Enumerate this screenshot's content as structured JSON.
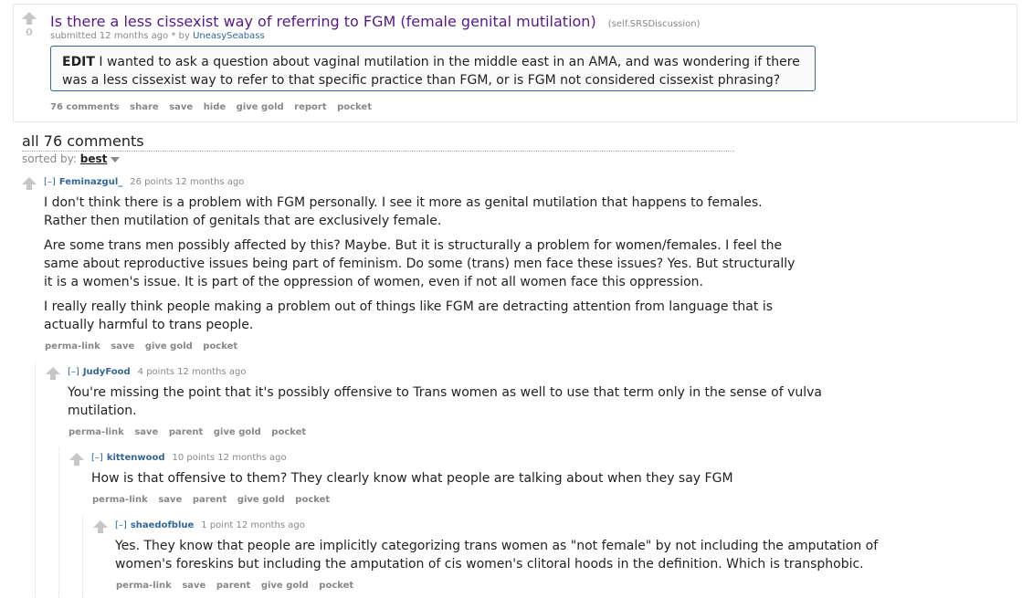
{
  "post": {
    "score": "0",
    "title": "Is there a less cissexist way of referring to FGM (female genital mutilation)",
    "domain": "(self.SRSDiscussion)",
    "tagline_prefix": "submitted 12 months ago * by",
    "author": "UneasySeabass",
    "selftext_bold": "EDIT",
    "selftext": " I wanted to ask a question about vaginal mutilation in the middle east in an AMA, and was wondering if there was a less cissexist way to refer to that specific practice than FGM, or is FGM not considered cissexist phrasing?",
    "buttons": [
      "76 comments",
      "share",
      "save",
      "hide",
      "give gold",
      "report",
      "pocket"
    ]
  },
  "comments_header": "all 76 comments",
  "sort": {
    "label": "sorted by:",
    "value": "best"
  },
  "comments": [
    {
      "expand": "[–]",
      "author": "Feminazgul_",
      "meta": "26 points 12 months ago",
      "paragraphs": [
        "I don't think there is a problem with FGM personally. I see it more as genital mutilation that happens to females. Rather then mutilation of genitals that are exclusively female.",
        "Are some trans men possibly affected by this? Maybe. But it is structurally a problem for women/females. I feel the same about reproductive issues being part of feminism. Do some (trans) men face these issues? Yes. But structurally it is a women's issue. It is part of the oppression of women, even if not all women face this oppression.",
        "I really really think people making a problem out of things like FGM are detracting attention from language that is actually harmful to trans people."
      ],
      "buttons": [
        "perma-link",
        "save",
        "give gold",
        "pocket"
      ]
    },
    {
      "expand": "[–]",
      "author": "JudyFood",
      "meta": "4 points 12 months ago",
      "paragraphs": [
        "You're missing the point that it's possibly offensive to Trans women as well to use that term only in the sense of vulva mutilation."
      ],
      "buttons": [
        "perma-link",
        "save",
        "parent",
        "give gold",
        "pocket"
      ]
    },
    {
      "expand": "[–]",
      "author": "kittenwood",
      "meta": "10 points 12 months ago",
      "paragraphs": [
        "How is that offensive to them? They clearly know what people are talking about when they say FGM"
      ],
      "buttons": [
        "perma-link",
        "save",
        "parent",
        "give gold",
        "pocket"
      ]
    },
    {
      "expand": "[–]",
      "author": "shaedofblue",
      "meta": "1 point 12 months ago",
      "paragraphs": [
        "Yes. They know that people are implicitly categorizing trans women as \"not female\" by not including the amputation of women's foreskins but including the amputation of cis women's clitoral hoods in the definition. Which is transphobic."
      ],
      "buttons": [
        "perma-link",
        "save",
        "parent",
        "give gold",
        "pocket"
      ]
    }
  ]
}
